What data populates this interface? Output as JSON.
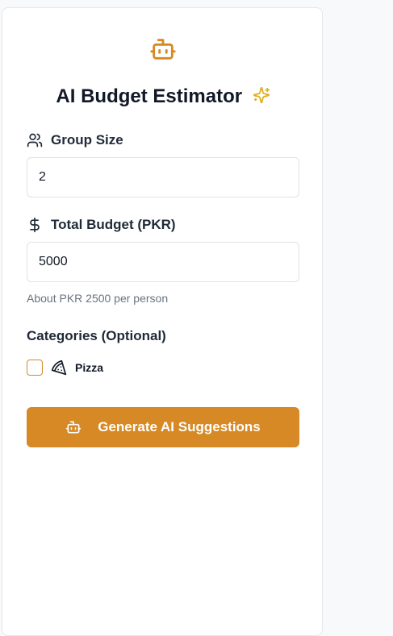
{
  "header": {
    "title": "AI Budget Estimator"
  },
  "group_size": {
    "label": "Group Size",
    "value": "2"
  },
  "budget": {
    "label": "Total Budget (PKR)",
    "value": "5000",
    "per_person_hint": "About PKR 2500 per person"
  },
  "categories": {
    "heading": "Categories (Optional)",
    "items": [
      {
        "label": "Pizza",
        "checked": false,
        "icon": "pizza-icon"
      }
    ]
  },
  "actions": {
    "generate_label": "Generate AI Suggestions"
  },
  "colors": {
    "accent": "#d68924",
    "sparkle": "#e0b020",
    "page_bg": "#f8f9fb",
    "text_primary": "#111827",
    "text_muted": "#6b7280"
  },
  "icons": {
    "header": "bot-icon",
    "title_badge": "sparkles-icon",
    "group_size": "users-icon",
    "budget": "dollar-icon",
    "button": "bot-icon"
  }
}
